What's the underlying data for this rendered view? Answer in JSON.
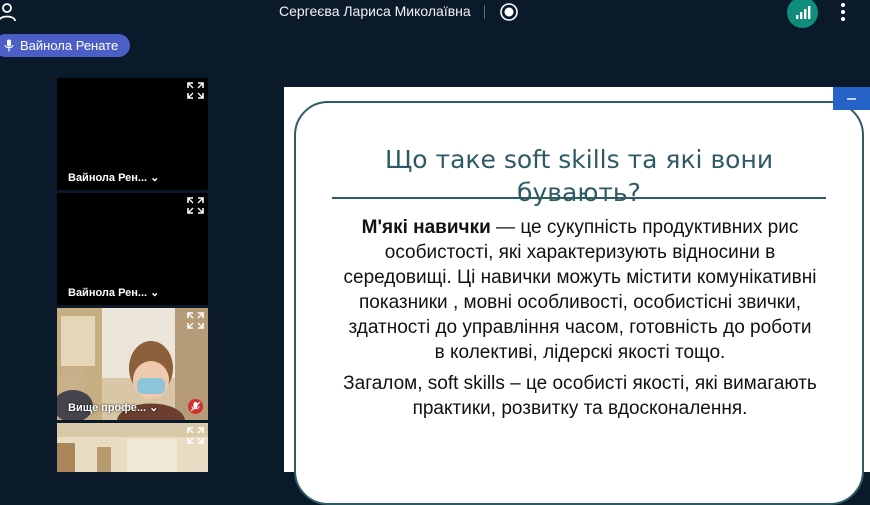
{
  "topbar": {
    "meeting_title": "Сергеєва Лариса Миколаївна"
  },
  "active_speaker": {
    "name": "Вайнола Ренате"
  },
  "participants": [
    {
      "name": "Вайнола Рен..."
    },
    {
      "name": "Вайнола Рен..."
    },
    {
      "name": "Вище профе..."
    }
  ],
  "slide": {
    "title": "Що таке soft skills та які вони бувають?",
    "body_bold": "М'які навички",
    "body_rest": " — це сукупність продуктивних рис особистості, які характеризують відносини в середовищі. Ці навички можуть містити комунікативні показники , мовні особливості, особистісні звички, здатності до управління часом, готовність до роботи в колективі, лідерскі якості тощо.",
    "body_p2": "Загалом, soft skills – це особисті якості, які вимагають практики, розвитку та вдосконалення."
  },
  "colors": {
    "background": "#0b1a2b",
    "speaker_pill": "#4c5fc6",
    "signal": "#0f8c7a",
    "title_text": "#2e5a66",
    "mic_off": "#d22f2f"
  }
}
